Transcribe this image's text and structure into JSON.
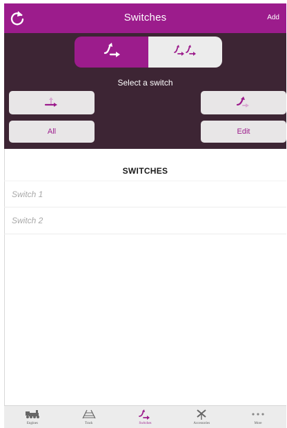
{
  "header": {
    "title": "Switches",
    "add_label": "Add",
    "refresh_icon": "refresh-icon"
  },
  "panel": {
    "segments": [
      {
        "icon": "single-switch-icon",
        "selected": true
      },
      {
        "icon": "double-switch-icon",
        "selected": false
      }
    ],
    "select_label": "Select a switch",
    "left_icon_button": "switch-straight-icon",
    "right_icon_button": "switch-turn-icon",
    "all_label": "All",
    "edit_label": "Edit"
  },
  "section": {
    "title": "SWITCHES"
  },
  "switches": [
    {
      "name": "Switch 1"
    },
    {
      "name": "Switch 2"
    }
  ],
  "tabbar": {
    "tabs": [
      {
        "label": "Engines",
        "icon": "engine-icon",
        "active": false
      },
      {
        "label": "Track",
        "icon": "track-icon",
        "active": false
      },
      {
        "label": "Switches",
        "icon": "switch-icon",
        "active": true
      },
      {
        "label": "Accessories",
        "icon": "crossing-icon",
        "active": false
      },
      {
        "label": "More",
        "icon": "more-icon",
        "active": false
      }
    ]
  },
  "colors": {
    "accent": "#9c1c8c",
    "panel_bg": "#3d2534",
    "button_bg": "#e8e6e7"
  }
}
